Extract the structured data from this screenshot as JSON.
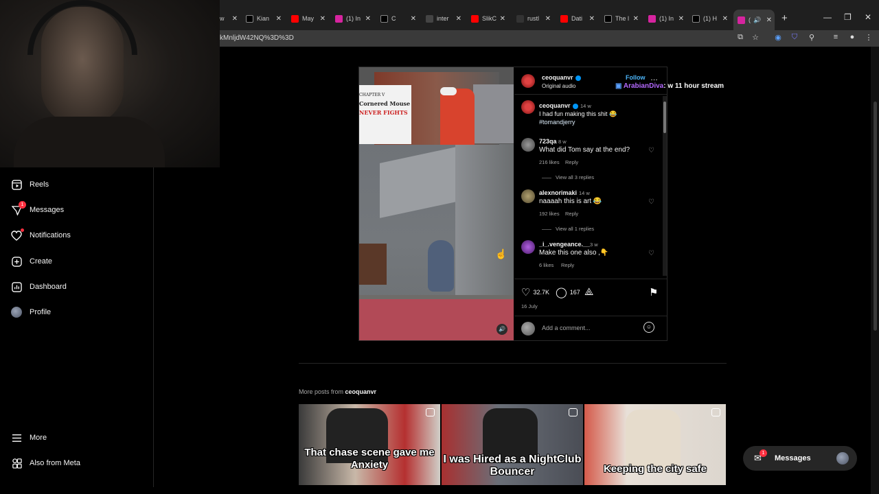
{
  "browser": {
    "tabs": [
      {
        "label": "w",
        "color": "#2d2d2d"
      },
      {
        "label": "Kian",
        "color": "#000000"
      },
      {
        "label": "May",
        "color": "#ff0000"
      },
      {
        "label": "(1) In",
        "color": "#d6249f"
      },
      {
        "label": "C",
        "color": "#000000"
      },
      {
        "label": "inter",
        "color": "#2d2d2d"
      },
      {
        "label": "SlikC",
        "color": "#ff0000"
      },
      {
        "label": "rustl",
        "color": "#333333"
      },
      {
        "label": "Dati",
        "color": "#ff0000"
      },
      {
        "label": "The l",
        "color": "#000000"
      },
      {
        "label": "(1) In",
        "color": "#d6249f"
      },
      {
        "label": "(1) H",
        "color": "#000000"
      },
      {
        "label": "(",
        "color": "#d6249f"
      }
    ],
    "url": "kMnljdW42NQ%3D%3D"
  },
  "sidebar": {
    "items": [
      {
        "label": "Reels",
        "icon": "reels-icon"
      },
      {
        "label": "Messages",
        "icon": "messages-icon",
        "badge": "1"
      },
      {
        "label": "Notifications",
        "icon": "heart-icon"
      },
      {
        "label": "Create",
        "icon": "plus-icon"
      },
      {
        "label": "Dashboard",
        "icon": "dashboard-icon"
      },
      {
        "label": "Profile",
        "icon": "avatar"
      }
    ],
    "bottom": [
      {
        "label": "More",
        "icon": "menu-icon"
      },
      {
        "label": "Also from Meta",
        "icon": "meta-icon"
      }
    ]
  },
  "post": {
    "video": {
      "sign_line1": "CHAPTER V",
      "sign_line2": "Cornered Mouse",
      "sign_line3": "NEVER FIGHTS"
    },
    "author": "ceoquanvr",
    "audio": "Original audio",
    "follow": "Follow",
    "caption": {
      "user": "ceoquanvr",
      "time": "14 w",
      "text": "I had fun making this shit 😂",
      "hashtag": "#tomandjerry"
    },
    "comments": [
      {
        "user": "723qa",
        "time": "8 w",
        "text": "What did Tom say at the end?",
        "likes": "216 likes",
        "reply": "Reply",
        "view_replies": "View all 3 replies",
        "avatar_color": "#7a7a7a"
      },
      {
        "user": "alexnorimaki",
        "time": "14 w",
        "text": "naaaah this is art 😂",
        "likes": "192 likes",
        "reply": "Reply",
        "view_replies": "View all 1 replies",
        "avatar_color": "#8a8060"
      },
      {
        "user": "_i_.vengeance.__",
        "time": "3 w",
        "text": "Make this one also ,👇",
        "likes": "6 likes",
        "reply": "Reply",
        "view_replies": "",
        "avatar_color": "#7a2aa0"
      }
    ],
    "likes": "32.7K",
    "comment_count": "167",
    "date": "16 July",
    "add_comment_placeholder": "Add a comment..."
  },
  "overlay": {
    "chat_user": "ArabianDiva",
    "chat_msg": ": w 11 hour stream"
  },
  "more_posts": {
    "prefix": "More posts from",
    "user": "ceoquanvr",
    "thumbs": [
      {
        "caption": "That chase scene gave me Anxiety"
      },
      {
        "caption": "I was Hired as a NightClub Bouncer"
      },
      {
        "caption": "Keeping the city safe"
      }
    ]
  },
  "messages_pill": {
    "label": "Messages",
    "badge": "1"
  },
  "colors": {
    "accent": "#0095f6",
    "follow": "#4cb5f9",
    "notification": "#ff3040"
  }
}
